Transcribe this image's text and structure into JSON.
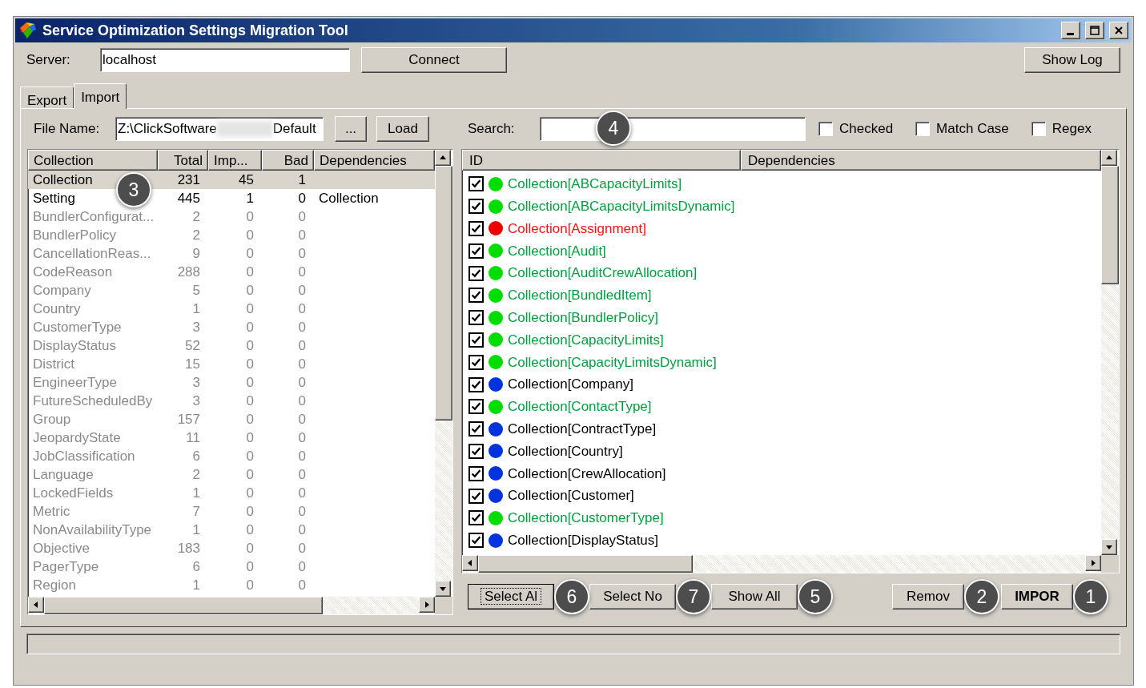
{
  "window": {
    "title": "Service Optimization Settings Migration Tool"
  },
  "server": {
    "label": "Server:",
    "value": "localhost"
  },
  "connect_button": "Connect",
  "show_log_button": "Show Log",
  "tabs": [
    {
      "label": "Export",
      "selected": false
    },
    {
      "label": "Import",
      "selected": true
    }
  ],
  "file": {
    "label": "File Name:",
    "value_start": "Z:\\ClickSoftware",
    "value_end": "Default"
  },
  "browse_button": "...",
  "load_button": "Load",
  "search": {
    "label": "Search:",
    "callout": "4"
  },
  "filters": [
    {
      "label": "Checked",
      "checked": false
    },
    {
      "label": "Match Case",
      "checked": false
    },
    {
      "label": "Regex",
      "checked": false
    }
  ],
  "collections": {
    "columns": [
      "Collection",
      "Total",
      "Imp...",
      "Bad",
      "Dependencies"
    ],
    "rows": [
      {
        "name": "Collection",
        "total": "231",
        "imported": "45",
        "bad": "1",
        "enabled": true,
        "selected": true,
        "callout": "3"
      },
      {
        "name": "Setting",
        "total": "445",
        "imported": "1",
        "bad": "0",
        "dependencies": "Collection",
        "enabled": true,
        "selected": false
      },
      {
        "name": "BundlerConfigurat...",
        "total": "2",
        "imported": "0",
        "bad": "0",
        "enabled": false,
        "selected": false
      },
      {
        "name": "BundlerPolicy",
        "total": "2",
        "imported": "0",
        "bad": "0",
        "enabled": false,
        "selected": false
      },
      {
        "name": "CancellationReas...",
        "total": "9",
        "imported": "0",
        "bad": "0",
        "enabled": false,
        "selected": false
      },
      {
        "name": "CodeReason",
        "total": "288",
        "imported": "0",
        "bad": "0",
        "enabled": false,
        "selected": false
      },
      {
        "name": "Company",
        "total": "5",
        "imported": "0",
        "bad": "0",
        "enabled": false,
        "selected": false
      },
      {
        "name": "Country",
        "total": "1",
        "imported": "0",
        "bad": "0",
        "enabled": false,
        "selected": false
      },
      {
        "name": "CustomerType",
        "total": "3",
        "imported": "0",
        "bad": "0",
        "enabled": false,
        "selected": false
      },
      {
        "name": "DisplayStatus",
        "total": "52",
        "imported": "0",
        "bad": "0",
        "enabled": false,
        "selected": false
      },
      {
        "name": "District",
        "total": "15",
        "imported": "0",
        "bad": "0",
        "enabled": false,
        "selected": false
      },
      {
        "name": "EngineerType",
        "total": "3",
        "imported": "0",
        "bad": "0",
        "enabled": false,
        "selected": false
      },
      {
        "name": "FutureScheduledBy",
        "total": "3",
        "imported": "0",
        "bad": "0",
        "enabled": false,
        "selected": false
      },
      {
        "name": "Group",
        "total": "157",
        "imported": "0",
        "bad": "0",
        "enabled": false,
        "selected": false
      },
      {
        "name": "JeopardyState",
        "total": "11",
        "imported": "0",
        "bad": "0",
        "enabled": false,
        "selected": false
      },
      {
        "name": "JobClassification",
        "total": "6",
        "imported": "0",
        "bad": "0",
        "enabled": false,
        "selected": false
      },
      {
        "name": "Language",
        "total": "2",
        "imported": "0",
        "bad": "0",
        "enabled": false,
        "selected": false
      },
      {
        "name": "LockedFields",
        "total": "1",
        "imported": "0",
        "bad": "0",
        "enabled": false,
        "selected": false
      },
      {
        "name": "Metric",
        "total": "7",
        "imported": "0",
        "bad": "0",
        "enabled": false,
        "selected": false
      },
      {
        "name": "NonAvailabilityType",
        "total": "1",
        "imported": "0",
        "bad": "0",
        "enabled": false,
        "selected": false
      },
      {
        "name": "Objective",
        "total": "183",
        "imported": "0",
        "bad": "0",
        "enabled": false,
        "selected": false
      },
      {
        "name": "PagerType",
        "total": "6",
        "imported": "0",
        "bad": "0",
        "enabled": false,
        "selected": false
      },
      {
        "name": "Region",
        "total": "1",
        "imported": "0",
        "bad": "0",
        "enabled": false,
        "selected": false
      }
    ]
  },
  "items": {
    "columns": [
      "ID",
      "Dependencies"
    ],
    "rows": [
      {
        "id": "Collection[ABCapacityLimits]",
        "checked": true,
        "kind": "new",
        "color": "#00dd00"
      },
      {
        "id": "Collection[ABCapacityLimitsDynamic]",
        "checked": true,
        "kind": "new",
        "color": "#00dd00"
      },
      {
        "id": "Collection[Assignment]",
        "checked": true,
        "kind": "conflict",
        "color": "#ee0000"
      },
      {
        "id": "Collection[Audit]",
        "checked": true,
        "kind": "new",
        "color": "#00dd00"
      },
      {
        "id": "Collection[AuditCrewAllocation]",
        "checked": true,
        "kind": "new",
        "color": "#00dd00"
      },
      {
        "id": "Collection[BundledItem]",
        "checked": true,
        "kind": "new",
        "color": "#00dd00"
      },
      {
        "id": "Collection[BundlerPolicy]",
        "checked": true,
        "kind": "new",
        "color": "#00dd00"
      },
      {
        "id": "Collection[CapacityLimits]",
        "checked": true,
        "kind": "new",
        "color": "#00dd00"
      },
      {
        "id": "Collection[CapacityLimitsDynamic]",
        "checked": true,
        "kind": "new",
        "color": "#00dd00"
      },
      {
        "id": "Collection[Company]",
        "checked": true,
        "kind": "existing",
        "color": "#0033dd"
      },
      {
        "id": "Collection[ContactType]",
        "checked": true,
        "kind": "new",
        "color": "#00dd00"
      },
      {
        "id": "Collection[ContractType]",
        "checked": true,
        "kind": "existing",
        "color": "#0033dd"
      },
      {
        "id": "Collection[Country]",
        "checked": true,
        "kind": "existing",
        "color": "#0033dd"
      },
      {
        "id": "Collection[CrewAllocation]",
        "checked": true,
        "kind": "existing",
        "color": "#0033dd"
      },
      {
        "id": "Collection[Customer]",
        "checked": true,
        "kind": "existing",
        "color": "#0033dd"
      },
      {
        "id": "Collection[CustomerType]",
        "checked": true,
        "kind": "new",
        "color": "#00dd00"
      },
      {
        "id": "Collection[DisplayStatus]",
        "checked": true,
        "kind": "existing",
        "color": "#0033dd"
      }
    ]
  },
  "buttons_left": [
    {
      "label": "Select Al",
      "callout": "6",
      "focused": true
    },
    {
      "label": "Select No",
      "callout": "7",
      "focused": false
    },
    {
      "label": "Show All",
      "callout": "5",
      "focused": false
    }
  ],
  "buttons_right": [
    {
      "label": "Remov",
      "callout": "2",
      "kind": "normal"
    },
    {
      "label": "IMPOR",
      "callout": "1",
      "kind": "default"
    }
  ]
}
